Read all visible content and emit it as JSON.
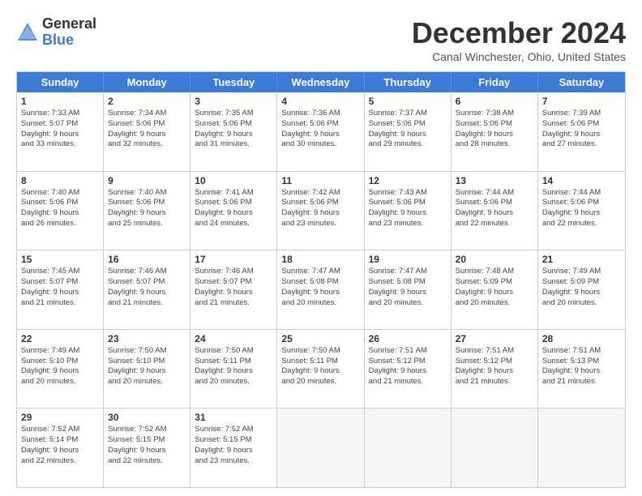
{
  "logo": {
    "general": "General",
    "blue": "Blue"
  },
  "title": "December 2024",
  "location": "Canal Winchester, Ohio, United States",
  "weekdays": [
    "Sunday",
    "Monday",
    "Tuesday",
    "Wednesday",
    "Thursday",
    "Friday",
    "Saturday"
  ],
  "weeks": [
    [
      {
        "day": "1",
        "lines": [
          "Sunrise: 7:33 AM",
          "Sunset: 5:07 PM",
          "Daylight: 9 hours",
          "and 33 minutes."
        ]
      },
      {
        "day": "2",
        "lines": [
          "Sunrise: 7:34 AM",
          "Sunset: 5:06 PM",
          "Daylight: 9 hours",
          "and 32 minutes."
        ]
      },
      {
        "day": "3",
        "lines": [
          "Sunrise: 7:35 AM",
          "Sunset: 5:06 PM",
          "Daylight: 9 hours",
          "and 31 minutes."
        ]
      },
      {
        "day": "4",
        "lines": [
          "Sunrise: 7:36 AM",
          "Sunset: 5:06 PM",
          "Daylight: 9 hours",
          "and 30 minutes."
        ]
      },
      {
        "day": "5",
        "lines": [
          "Sunrise: 7:37 AM",
          "Sunset: 5:06 PM",
          "Daylight: 9 hours",
          "and 29 minutes."
        ]
      },
      {
        "day": "6",
        "lines": [
          "Sunrise: 7:38 AM",
          "Sunset: 5:06 PM",
          "Daylight: 9 hours",
          "and 28 minutes."
        ]
      },
      {
        "day": "7",
        "lines": [
          "Sunrise: 7:39 AM",
          "Sunset: 5:06 PM",
          "Daylight: 9 hours",
          "and 27 minutes."
        ]
      }
    ],
    [
      {
        "day": "8",
        "lines": [
          "Sunrise: 7:40 AM",
          "Sunset: 5:06 PM",
          "Daylight: 9 hours",
          "and 26 minutes."
        ]
      },
      {
        "day": "9",
        "lines": [
          "Sunrise: 7:40 AM",
          "Sunset: 5:06 PM",
          "Daylight: 9 hours",
          "and 25 minutes."
        ]
      },
      {
        "day": "10",
        "lines": [
          "Sunrise: 7:41 AM",
          "Sunset: 5:06 PM",
          "Daylight: 9 hours",
          "and 24 minutes."
        ]
      },
      {
        "day": "11",
        "lines": [
          "Sunrise: 7:42 AM",
          "Sunset: 5:06 PM",
          "Daylight: 9 hours",
          "and 23 minutes."
        ]
      },
      {
        "day": "12",
        "lines": [
          "Sunrise: 7:43 AM",
          "Sunset: 5:06 PM",
          "Daylight: 9 hours",
          "and 23 minutes."
        ]
      },
      {
        "day": "13",
        "lines": [
          "Sunrise: 7:44 AM",
          "Sunset: 5:06 PM",
          "Daylight: 9 hours",
          "and 22 minutes."
        ]
      },
      {
        "day": "14",
        "lines": [
          "Sunrise: 7:44 AM",
          "Sunset: 5:06 PM",
          "Daylight: 9 hours",
          "and 22 minutes."
        ]
      }
    ],
    [
      {
        "day": "15",
        "lines": [
          "Sunrise: 7:45 AM",
          "Sunset: 5:07 PM",
          "Daylight: 9 hours",
          "and 21 minutes."
        ]
      },
      {
        "day": "16",
        "lines": [
          "Sunrise: 7:46 AM",
          "Sunset: 5:07 PM",
          "Daylight: 9 hours",
          "and 21 minutes."
        ]
      },
      {
        "day": "17",
        "lines": [
          "Sunrise: 7:46 AM",
          "Sunset: 5:07 PM",
          "Daylight: 9 hours",
          "and 21 minutes."
        ]
      },
      {
        "day": "18",
        "lines": [
          "Sunrise: 7:47 AM",
          "Sunset: 5:08 PM",
          "Daylight: 9 hours",
          "and 20 minutes."
        ]
      },
      {
        "day": "19",
        "lines": [
          "Sunrise: 7:47 AM",
          "Sunset: 5:08 PM",
          "Daylight: 9 hours",
          "and 20 minutes."
        ]
      },
      {
        "day": "20",
        "lines": [
          "Sunrise: 7:48 AM",
          "Sunset: 5:09 PM",
          "Daylight: 9 hours",
          "and 20 minutes."
        ]
      },
      {
        "day": "21",
        "lines": [
          "Sunrise: 7:49 AM",
          "Sunset: 5:09 PM",
          "Daylight: 9 hours",
          "and 20 minutes."
        ]
      }
    ],
    [
      {
        "day": "22",
        "lines": [
          "Sunrise: 7:49 AM",
          "Sunset: 5:10 PM",
          "Daylight: 9 hours",
          "and 20 minutes."
        ]
      },
      {
        "day": "23",
        "lines": [
          "Sunrise: 7:50 AM",
          "Sunset: 5:10 PM",
          "Daylight: 9 hours",
          "and 20 minutes."
        ]
      },
      {
        "day": "24",
        "lines": [
          "Sunrise: 7:50 AM",
          "Sunset: 5:11 PM",
          "Daylight: 9 hours",
          "and 20 minutes."
        ]
      },
      {
        "day": "25",
        "lines": [
          "Sunrise: 7:50 AM",
          "Sunset: 5:11 PM",
          "Daylight: 9 hours",
          "and 20 minutes."
        ]
      },
      {
        "day": "26",
        "lines": [
          "Sunrise: 7:51 AM",
          "Sunset: 5:12 PM",
          "Daylight: 9 hours",
          "and 21 minutes."
        ]
      },
      {
        "day": "27",
        "lines": [
          "Sunrise: 7:51 AM",
          "Sunset: 5:12 PM",
          "Daylight: 9 hours",
          "and 21 minutes."
        ]
      },
      {
        "day": "28",
        "lines": [
          "Sunrise: 7:51 AM",
          "Sunset: 5:13 PM",
          "Daylight: 9 hours",
          "and 21 minutes."
        ]
      }
    ],
    [
      {
        "day": "29",
        "lines": [
          "Sunrise: 7:52 AM",
          "Sunset: 5:14 PM",
          "Daylight: 9 hours",
          "and 22 minutes."
        ]
      },
      {
        "day": "30",
        "lines": [
          "Sunrise: 7:52 AM",
          "Sunset: 5:15 PM",
          "Daylight: 9 hours",
          "and 22 minutes."
        ]
      },
      {
        "day": "31",
        "lines": [
          "Sunrise: 7:52 AM",
          "Sunset: 5:15 PM",
          "Daylight: 9 hours",
          "and 23 minutes."
        ]
      },
      {
        "day": "",
        "lines": []
      },
      {
        "day": "",
        "lines": []
      },
      {
        "day": "",
        "lines": []
      },
      {
        "day": "",
        "lines": []
      }
    ]
  ]
}
